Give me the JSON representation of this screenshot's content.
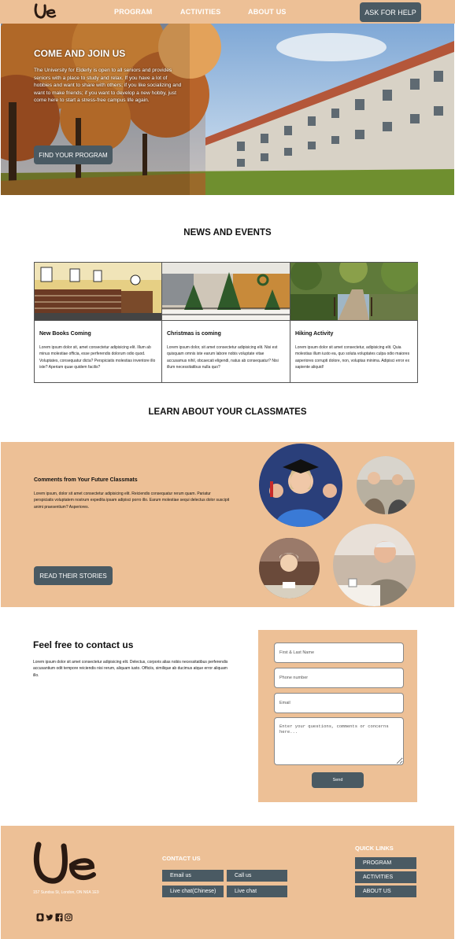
{
  "header": {
    "logo_icon": "ue-logo-icon",
    "nav": [
      "PROGRAM",
      "ACTIVITIES",
      "ABOUT US"
    ],
    "help_label": "ASK FOR HELP"
  },
  "hero": {
    "title": "COME AND JOIN US",
    "text": "The University for Elderly is open to all seniors and provides seniors with a place to study and relax. If you have a lot of hobbies and want to share with others; if you like socializing and want to make friends; if you want to develop a new hobby, just come here to start a stress-free campus life again.",
    "button_label": "FIND YOUR PROGRAM"
  },
  "news": {
    "heading": "NEWS AND EVENTS",
    "cards": [
      {
        "title": "New Books Coming",
        "body": "Lorem ipsum dolor sit, amet consectetur adipisicing elit. Illum ab minus molestiae officia, esse perferendis dolorum odio quod. Voluptates, consequatur dicta? Perspiciatis molestias inventore illo iste? Aperiam quae quidem facilis?"
      },
      {
        "title": "Christmas is coming",
        "body": "Lorem ipsum dolor, sit amet consectetur adipisicing elit. Nisi est quisquam omnis iste earum labore nobis voluptate vitae accusamus nihil, obcaecati eligendi, natus ab consequatur? Nisi illum necessitatibus nulla quo?"
      },
      {
        "title": "Hiking Activity",
        "body": "Lorem ipsum dolor sit amet consectetur, adipisicing elit. Quia molestias illum iusto ea, quo soluta voluptates culpa odio maiores asperiores corrupti dolore, non, voluptas minima. Adipisci error ex sapiente aliquid!"
      }
    ]
  },
  "classmates": {
    "heading": "LEARN ABOUT YOUR CLASSMATES",
    "title": "Comments from Your Future Classmats",
    "body": "Lorem ipsum, dolor sit amet consectetur adipisicing elit. Reiciendis consequatur rerum quam. Pariatur perspiciatis voluptatem nostrum expedita ipsam adipisci porro illo. Earum molestiae sequi delectus dolor suscipit animi praesentium? Asperiores.",
    "button_label": "READ THEIR STORIES"
  },
  "contact": {
    "title": "Feel free to contact us",
    "body": "Lorem ipsum dolor sit amet consectetur adipisicing elit. Delectus, corporis alias nobis necessitatibus perferendis accusantium odit tempore reiciendis nisi rerum, aliquam iusto. Officiis, similique ab ducimus atque error aliquam illo.",
    "placeholders": {
      "name": "First & Last Name",
      "phone": "Phone number",
      "email": "Email",
      "message": "Enter your questions, comments or concerns here..."
    },
    "send_label": "Send"
  },
  "footer": {
    "address": "157 Sundsa St, London, ON N6A 1E9",
    "contact_heading": "CONTACT US",
    "contact_buttons": [
      "Email us",
      "Call us",
      "Live chat(Chinese)",
      "Live chat"
    ],
    "links_heading": "QUICK LINKS",
    "links": [
      "PROGRAM",
      "ACTIVITIES",
      "ABOUT US"
    ],
    "social_icons": [
      "snapchat-icon",
      "twitter-icon",
      "facebook-icon",
      "instagram-icon"
    ]
  },
  "colors": {
    "accent": "#edc096",
    "button": "#4a5a63"
  }
}
